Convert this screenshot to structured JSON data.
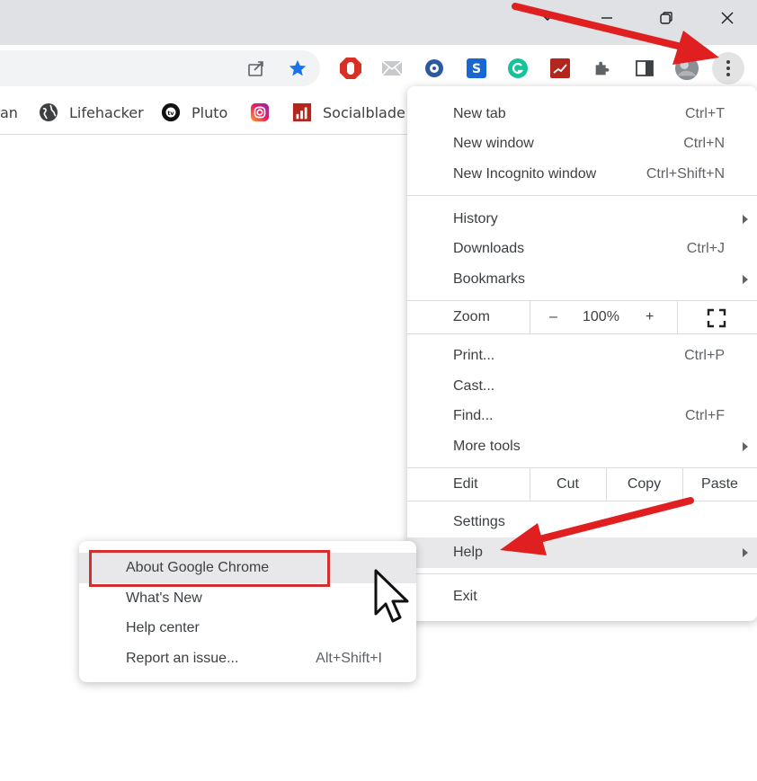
{
  "bookmarks": [
    {
      "label": "an",
      "icon": "none"
    },
    {
      "label": "Lifehacker",
      "icon": "globe-icon"
    },
    {
      "label": "Pluto",
      "icon": "pluto-tv-icon"
    },
    {
      "label": "",
      "icon": "instagram-icon"
    },
    {
      "label": "Socialblade",
      "icon": "socialblade-icon"
    }
  ],
  "menu": {
    "new_tab": {
      "label": "New tab",
      "shortcut": "Ctrl+T"
    },
    "new_window": {
      "label": "New window",
      "shortcut": "Ctrl+N"
    },
    "new_incognito": {
      "label": "New Incognito window",
      "shortcut": "Ctrl+Shift+N"
    },
    "history": {
      "label": "History"
    },
    "downloads": {
      "label": "Downloads",
      "shortcut": "Ctrl+J"
    },
    "bookmarks": {
      "label": "Bookmarks"
    },
    "zoom": {
      "label": "Zoom",
      "minus": "–",
      "level": "100%",
      "plus": "+"
    },
    "print": {
      "label": "Print...",
      "shortcut": "Ctrl+P"
    },
    "cast": {
      "label": "Cast..."
    },
    "find": {
      "label": "Find...",
      "shortcut": "Ctrl+F"
    },
    "more_tools": {
      "label": "More tools"
    },
    "edit": {
      "label": "Edit",
      "cut": "Cut",
      "copy": "Copy",
      "paste": "Paste"
    },
    "settings": {
      "label": "Settings"
    },
    "help": {
      "label": "Help"
    },
    "exit": {
      "label": "Exit"
    }
  },
  "help_submenu": {
    "about": {
      "label": "About Google Chrome"
    },
    "whats_new": {
      "label": "What's New"
    },
    "help_center": {
      "label": "Help center"
    },
    "report_issue": {
      "label": "Report an issue...",
      "shortcut": "Alt+Shift+I"
    }
  },
  "colors": {
    "annotation_red": "#e02020",
    "highlight_box": "#d32f2f",
    "bookmark_star": "#1a73e8"
  }
}
